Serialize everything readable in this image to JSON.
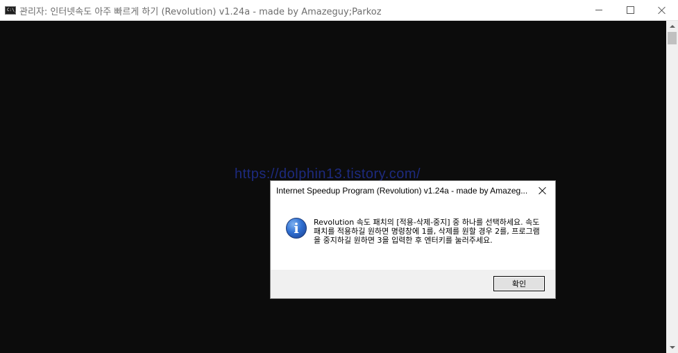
{
  "window": {
    "title": "관리자:  인터넷속도 아주 빠르게 하기 (Revolution) v1.24a - made by Amazeguy;Parkoz",
    "icon_text": "C:\\_"
  },
  "console": {
    "watermark": "https://dolphin13.tistory.com/"
  },
  "dialog": {
    "title": "Internet Speedup Program (Revolution) v1.24a - made by Amazeg...",
    "icon": "i",
    "message": "Revolution 속도 패치의 [적용-삭제-중지] 중 하나를 선택하세요. 속도패치를 적용하길 원하면 명령창에 1를, 삭제를 원할 경우 2를, 프로그램을 중지하길 원하면 3을 입력한 후 엔터키를 눌러주세요.",
    "ok_label": "확인"
  },
  "colors": {
    "console_bg": "#0c0c0c",
    "watermark": "#1d2a7e",
    "dialog_footer": "#f0f0f0"
  }
}
